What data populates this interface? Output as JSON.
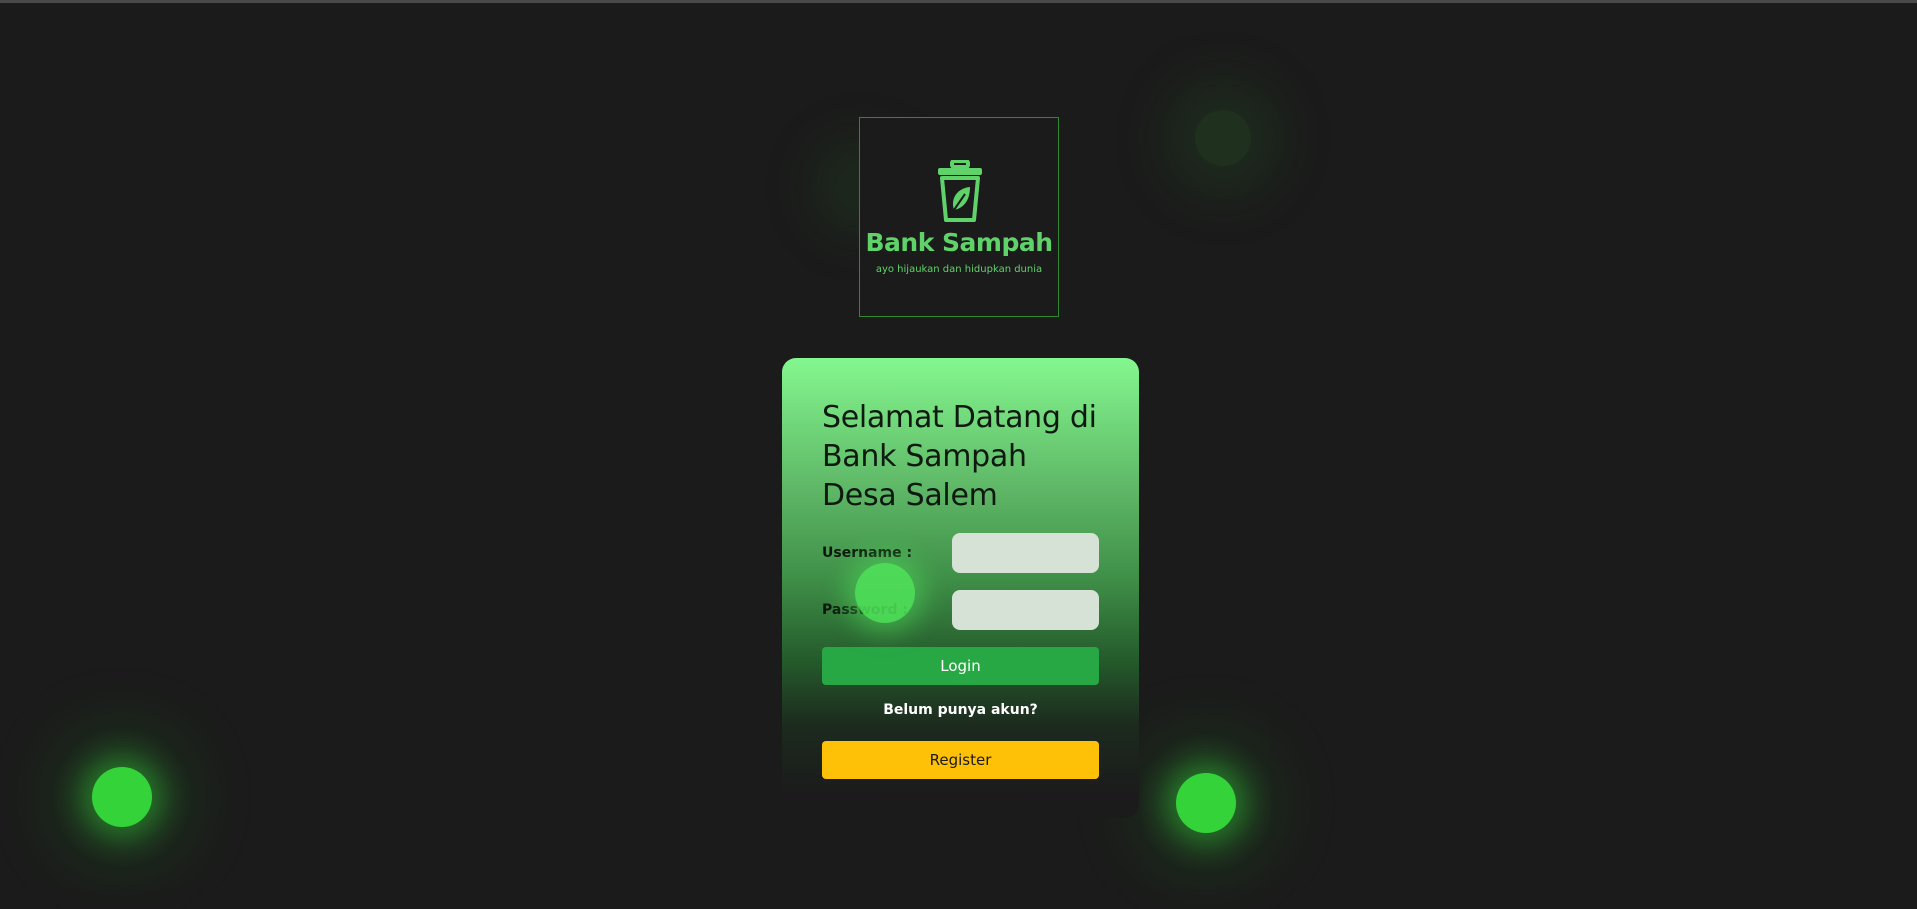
{
  "logo": {
    "title": "Bank Sampah",
    "tagline": "ayo hijaukan dan hidupkan dunia",
    "icon": "trash-bin-leaf-icon"
  },
  "login_card": {
    "title": "Selamat Datang di Bank Sampah Desa Salem",
    "username_label": "Username :",
    "username_value": "",
    "password_label": "Password :",
    "password_value": "",
    "login_button": "Login",
    "no_account_text": "Belum punya akun?",
    "register_button": "Register"
  },
  "colors": {
    "background": "#1b1b1b",
    "accent_green": "#5fd36a",
    "orb_green": "#34d33a",
    "login_button": "#28a745",
    "register_button": "#ffc107"
  }
}
